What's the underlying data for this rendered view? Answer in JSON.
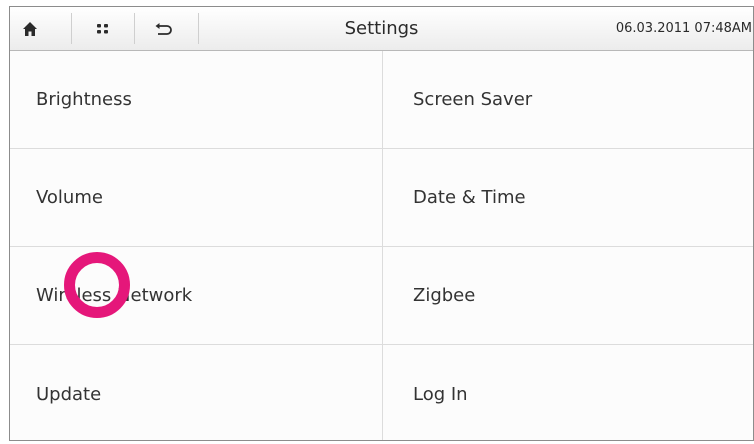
{
  "window": {
    "title": "Settings",
    "datetime": "06.03.2011 07:48AM"
  },
  "toolbar": {
    "home_icon": "home-icon",
    "apps_icon": "apps-grid-icon",
    "back_icon": "back-arrow-icon"
  },
  "menu": {
    "left": [
      {
        "label": "Brightness"
      },
      {
        "label": "Volume"
      },
      {
        "label": "Wireless Network"
      },
      {
        "label": "Update"
      }
    ],
    "right": [
      {
        "label": "Screen Saver"
      },
      {
        "label": "Date & Time"
      },
      {
        "label": "Zigbee"
      },
      {
        "label": "Log In"
      }
    ]
  },
  "highlight": {
    "marker_color": "#e5177a",
    "target": "Wireless Network"
  }
}
